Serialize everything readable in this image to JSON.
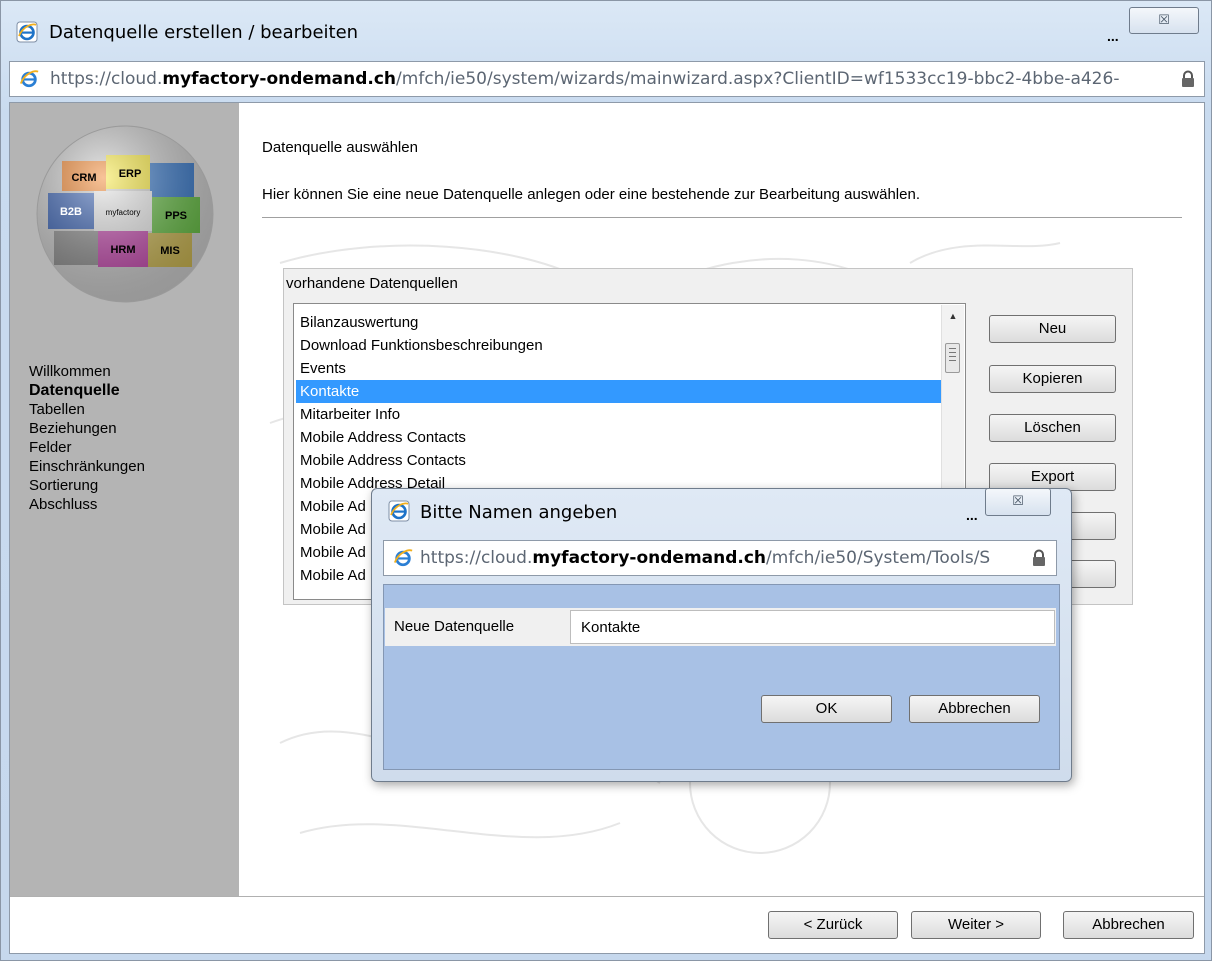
{
  "window": {
    "title": "Datenquelle erstellen / bearbeiten",
    "dots": "...",
    "close_symbol": "☒",
    "url": {
      "scheme": "https://",
      "pre": "cloud.",
      "domain": "myfactory-ondemand.ch",
      "path": "/mfch/ie50/system/wizards/mainwizard.aspx?ClientID=wf1533cc19-bbc2-4bbe-a426-"
    }
  },
  "sidebar": {
    "logo_labels": [
      "CRM",
      "ERP",
      "B2B",
      "myfactory",
      "PPS",
      "HRM",
      "MIS"
    ],
    "nav": [
      {
        "label": "Willkommen",
        "active": false
      },
      {
        "label": "Datenquelle",
        "active": true
      },
      {
        "label": "Tabellen",
        "active": false
      },
      {
        "label": "Beziehungen",
        "active": false
      },
      {
        "label": "Felder",
        "active": false
      },
      {
        "label": "Einschränkungen",
        "active": false
      },
      {
        "label": "Sortierung",
        "active": false
      },
      {
        "label": "Abschluss",
        "active": false
      }
    ]
  },
  "main": {
    "title": "Datenquelle auswählen",
    "description": "Hier können Sie eine neue Datenquelle anlegen oder eine bestehende zur Bearbeitung auswählen.",
    "group_label": "vorhandene Datenquellen",
    "list": [
      "Bilanzauswertung",
      "Download Funktionsbeschreibungen",
      "Events",
      "Kontakte",
      "Mitarbeiter Info",
      "Mobile Address Contacts",
      "Mobile Address Contacts",
      "Mobile Address Detail",
      "Mobile Ad",
      "Mobile Ad",
      "Mobile Ad",
      "Mobile Ad"
    ],
    "selected_index": 3,
    "buttons": {
      "new": "Neu",
      "copy": "Kopieren",
      "delete": "Löschen",
      "export": "Export",
      "hidden1": "",
      "hidden2": ""
    }
  },
  "footer": {
    "back": "< Zurück",
    "next": "Weiter >",
    "cancel": "Abbrechen"
  },
  "dialog": {
    "title": "Bitte Namen angeben",
    "dots": "...",
    "close_symbol": "☒",
    "url": {
      "scheme": "https://",
      "pre": "cloud.",
      "domain": "myfactory-ondemand.ch",
      "path": "/mfch/ie50/System/Tools/S"
    },
    "field_label": "Neue Datenquelle",
    "field_value": "Kontakte",
    "ok": "OK",
    "cancel": "Abbrechen"
  }
}
